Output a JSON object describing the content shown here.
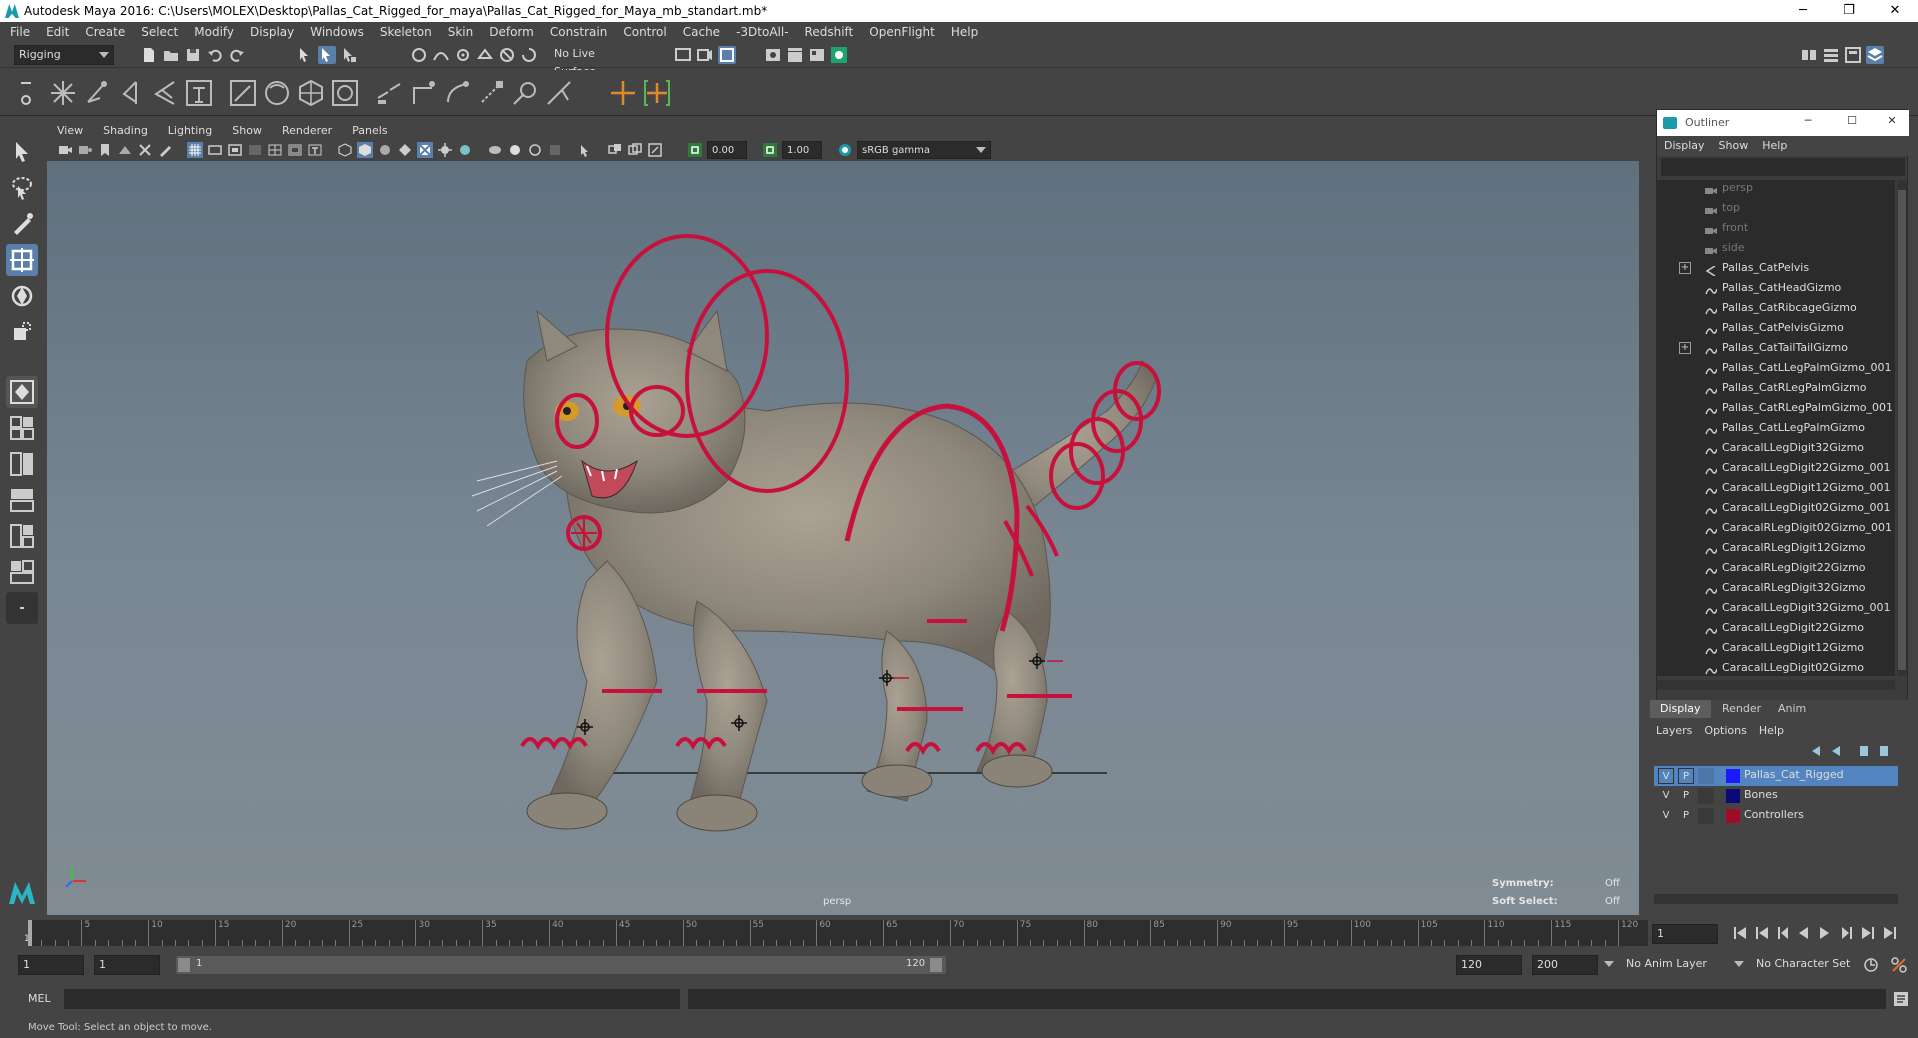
{
  "window": {
    "title": "Autodesk Maya 2016: C:\\Users\\MOLEX\\Desktop\\Pallas_Cat_Rigged_for_maya\\Pallas_Cat_Rigged_for_Maya_mb_standart.mb*",
    "minimize": "─",
    "maximize": "❐",
    "close": "✕"
  },
  "menubar": [
    "File",
    "Edit",
    "Create",
    "Select",
    "Modify",
    "Display",
    "Windows",
    "Skeleton",
    "Skin",
    "Deform",
    "Constrain",
    "Control",
    "Cache",
    "-3DtoAll-",
    "Redshift",
    "OpenFlight",
    "Help"
  ],
  "statusline": {
    "menuset": "Rigging",
    "live_surface": "No Live Surface"
  },
  "panel": {
    "menus": [
      "View",
      "Shading",
      "Lighting",
      "Show",
      "Renderer",
      "Panels"
    ],
    "exposure": "0.00",
    "gamma": "1.00",
    "colorspace": "sRGB gamma"
  },
  "viewport": {
    "camera_label": "persp",
    "symmetry_label": "Symmetry:",
    "symmetry_value": "Off",
    "soft_select_label": "Soft Select:",
    "soft_select_value": "Off",
    "accent_rig": "#c8103c"
  },
  "timeline": {
    "ticks": [
      "5",
      "10",
      "15",
      "20",
      "25",
      "30",
      "35",
      "40",
      "45",
      "50",
      "55",
      "60",
      "65",
      "70",
      "75",
      "80",
      "85",
      "90",
      "95",
      "100",
      "105",
      "110",
      "115",
      "120"
    ],
    "start_label": "1",
    "current_frame": "1"
  },
  "rangebar": {
    "start_time": "1",
    "playback_start": "1",
    "range_start": "1",
    "range_end": "120",
    "playback_end": "120",
    "end_time": "200",
    "anim_layer": "No Anim Layer",
    "character_set": "No Character Set"
  },
  "cmdline": {
    "label": "MEL"
  },
  "helpline": {
    "text": "Move Tool: Select an object to move."
  },
  "outliner": {
    "title": "Outliner",
    "menus": [
      "Display",
      "Show",
      "Help"
    ],
    "items": [
      {
        "label": "persp",
        "type": "camera"
      },
      {
        "label": "top",
        "type": "camera"
      },
      {
        "label": "front",
        "type": "camera"
      },
      {
        "label": "side",
        "type": "camera"
      },
      {
        "label": "Pallas_CatPelvis",
        "type": "joint",
        "expandable": true
      },
      {
        "label": "Pallas_CatHeadGizmo",
        "type": "curve"
      },
      {
        "label": "Pallas_CatRibcageGizmo",
        "type": "curve"
      },
      {
        "label": "Pallas_CatPelvisGizmo",
        "type": "curve"
      },
      {
        "label": "Pallas_CatTailTailGizmo",
        "type": "curve",
        "expandable": true
      },
      {
        "label": "Pallas_CatLLegPalmGizmo_001",
        "type": "curve"
      },
      {
        "label": "Pallas_CatRLegPalmGizmo",
        "type": "curve"
      },
      {
        "label": "Pallas_CatRLegPalmGizmo_001",
        "type": "curve"
      },
      {
        "label": "Pallas_CatLLegPalmGizmo",
        "type": "curve"
      },
      {
        "label": "CaracalLLegDigit32Gizmo",
        "type": "curve"
      },
      {
        "label": "CaracalLLegDigit22Gizmo_001",
        "type": "curve"
      },
      {
        "label": "CaracalLLegDigit12Gizmo_001",
        "type": "curve"
      },
      {
        "label": "CaracalLLegDigit02Gizmo_001",
        "type": "curve"
      },
      {
        "label": "CaracalRLegDigit02Gizmo_001",
        "type": "curve"
      },
      {
        "label": "CaracalRLegDigit12Gizmo",
        "type": "curve"
      },
      {
        "label": "CaracalRLegDigit22Gizmo",
        "type": "curve"
      },
      {
        "label": "CaracalRLegDigit32Gizmo",
        "type": "curve"
      },
      {
        "label": "CaracalLLegDigit32Gizmo_001",
        "type": "curve"
      },
      {
        "label": "CaracalLLegDigit22Gizmo",
        "type": "curve"
      },
      {
        "label": "CaracalLLegDigit12Gizmo",
        "type": "curve"
      },
      {
        "label": "CaracalLLegDigit02Gizmo",
        "type": "curve"
      }
    ]
  },
  "layer_editor": {
    "tabs": [
      "Display",
      "Render",
      "Anim"
    ],
    "menus": [
      "Layers",
      "Options",
      "Help"
    ],
    "layers": [
      {
        "v": "V",
        "p": "P",
        "name": "Pallas_Cat_Rigged",
        "color": "#1a1aff",
        "selected": true
      },
      {
        "v": "V",
        "p": "P",
        "name": "Bones",
        "color": "#0a0a78",
        "selected": false
      },
      {
        "v": "V",
        "p": "P",
        "name": "Controllers",
        "color": "#a00c28",
        "selected": false
      }
    ]
  }
}
